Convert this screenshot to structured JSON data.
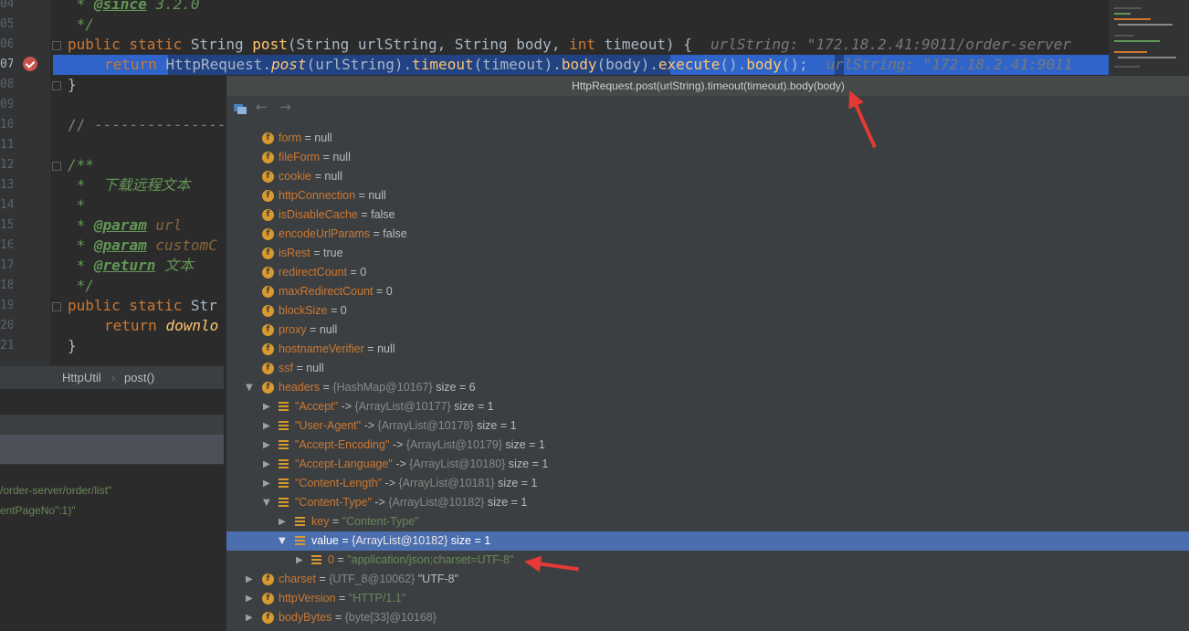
{
  "editor": {
    "lines": [
      {
        "number": "04"
      },
      {
        "number": "05"
      },
      {
        "number": "06"
      },
      {
        "number": "07"
      },
      {
        "number": "08"
      },
      {
        "number": "09"
      },
      {
        "number": "10"
      },
      {
        "number": "11"
      },
      {
        "number": "12"
      },
      {
        "number": "13"
      },
      {
        "number": "14"
      },
      {
        "number": "15"
      },
      {
        "number": "16"
      },
      {
        "number": "17"
      },
      {
        "number": "18"
      },
      {
        "number": "19"
      },
      {
        "number": "20"
      },
      {
        "number": "21"
      }
    ],
    "code": {
      "l04_star": " * ",
      "l04_tag": "@since",
      "l04_text": " 3.2.0",
      "l05": " */",
      "l06_kw": "public static ",
      "l06_type": "String ",
      "l06_fn": "post",
      "l06_args_a": "(String urlString, String body, ",
      "l06_int": "int ",
      "l06_args_b": "timeout) {",
      "l06_hint": "urlString: \"172.18.2.41:9011/order-server",
      "l07_ret": "return ",
      "l07_a": "HttpRequest.",
      "l07_post": "post",
      "l07_b": "(urlString).",
      "l07_timeout": "timeout",
      "l07_c": "(timeout).",
      "l07_body": "body",
      "l07_d": "(body)",
      "l07_e": ".",
      "l07_execute": "execute",
      "l07_f": "().",
      "l07_body2": "body",
      "l07_g": "();",
      "l07_hint": "urlString: \"172.18.2.41:9011",
      "l08": "}",
      "l10": "// ----------------",
      "l12": "/**",
      "l13": " *  下载远程文本",
      "l14": " *",
      "l15_star": " * ",
      "l15_tag": "@param",
      "l15_text": " url",
      "l16_star": " * ",
      "l16_tag": "@param",
      "l16_text": " customC",
      "l17_star": " * ",
      "l17_tag": "@return",
      "l17_text": " 文本",
      "l18": " */",
      "l19_kw": "public static ",
      "l19_rest": "Str",
      "l20_ret": "return ",
      "l20_fn": "downlo",
      "l21": "}"
    }
  },
  "breadcrumb": {
    "class_name": "HttpUtil",
    "method_name": "post()"
  },
  "left_panel": {
    "line1": "/order-server/order/list\"",
    "line2": "entPageNo\":1)\""
  },
  "popup": {
    "title": "HttpRequest.post(urlString).timeout(timeout).body(body)",
    "back_arrow": "←",
    "forward_arrow": "→",
    "rows": [
      {
        "name": "form",
        "eq": " = ",
        "value": "null"
      },
      {
        "name": "fileForm",
        "eq": " = ",
        "value": "null"
      },
      {
        "name": "cookie",
        "eq": " = ",
        "value": "null"
      },
      {
        "name": "httpConnection",
        "eq": " = ",
        "value": "null"
      },
      {
        "name": "isDisableCache",
        "eq": " = ",
        "value": "false"
      },
      {
        "name": "encodeUrlParams",
        "eq": " = ",
        "value": "false"
      },
      {
        "name": "isRest",
        "eq": " = ",
        "value": "true"
      },
      {
        "name": "redirectCount",
        "eq": " = ",
        "value": "0"
      },
      {
        "name": "maxRedirectCount",
        "eq": " = ",
        "value": "0"
      },
      {
        "name": "blockSize",
        "eq": " = ",
        "value": "0"
      },
      {
        "name": "proxy",
        "eq": " = ",
        "value": "null"
      },
      {
        "name": "hostnameVerifier",
        "eq": " = ",
        "value": "null"
      },
      {
        "name": "ssf",
        "eq": " = ",
        "value": "null"
      },
      {
        "name": "headers",
        "eq": " = ",
        "type": "{HashMap@10167}",
        "extra": "  size = 6"
      },
      {
        "key": "\"Accept\"",
        "arrow": " -> ",
        "type": "{ArrayList@10177}",
        "extra": "  size = 1"
      },
      {
        "key": "\"User-Agent\"",
        "arrow": " -> ",
        "type": "{ArrayList@10178}",
        "extra": "  size = 1"
      },
      {
        "key": "\"Accept-Encoding\"",
        "arrow": " -> ",
        "type": "{ArrayList@10179}",
        "extra": "  size = 1"
      },
      {
        "key": "\"Accept-Language\"",
        "arrow": " -> ",
        "type": "{ArrayList@10180}",
        "extra": "  size = 1"
      },
      {
        "key": "\"Content-Length\"",
        "arrow": " -> ",
        "type": "{ArrayList@10181}",
        "extra": "  size = 1"
      },
      {
        "key": "\"Content-Type\"",
        "arrow": " -> ",
        "type": "{ArrayList@10182}",
        "extra": "  size = 1"
      },
      {
        "name": "key",
        "eq": " = ",
        "str": "\"Content-Type\""
      },
      {
        "name": "value",
        "eq": " = ",
        "type": "{ArrayList@10182}",
        "extra": "  size = 1"
      },
      {
        "name": "0",
        "eq": " = ",
        "str": "\"application/json;charset=UTF-8\""
      },
      {
        "name": "charset",
        "eq": " = ",
        "type": "{UTF_8@10062}",
        "str": " \"UTF-8\""
      },
      {
        "name": "httpVersion",
        "eq": " = ",
        "str": "\"HTTP/1.1\""
      },
      {
        "name": "bodyBytes",
        "eq": " = ",
        "type": "{byte[33]@10168}"
      }
    ]
  },
  "colors": {
    "editor_bg": "#2b2b2b",
    "keyword": "#cc7832",
    "method": "#ffc66d",
    "comment": "#629755",
    "selection": "#214283",
    "tree_selection": "#4b6eaf",
    "field_icon": "#d69a2e",
    "annotation_arrow": "#e53935"
  },
  "icons": {
    "breakpoint": "breakpoint-check-icon",
    "field": "field-f-icon",
    "map_entry": "map-entry-icon",
    "expand": "triangle-right-icon",
    "collapse": "triangle-down-icon"
  }
}
